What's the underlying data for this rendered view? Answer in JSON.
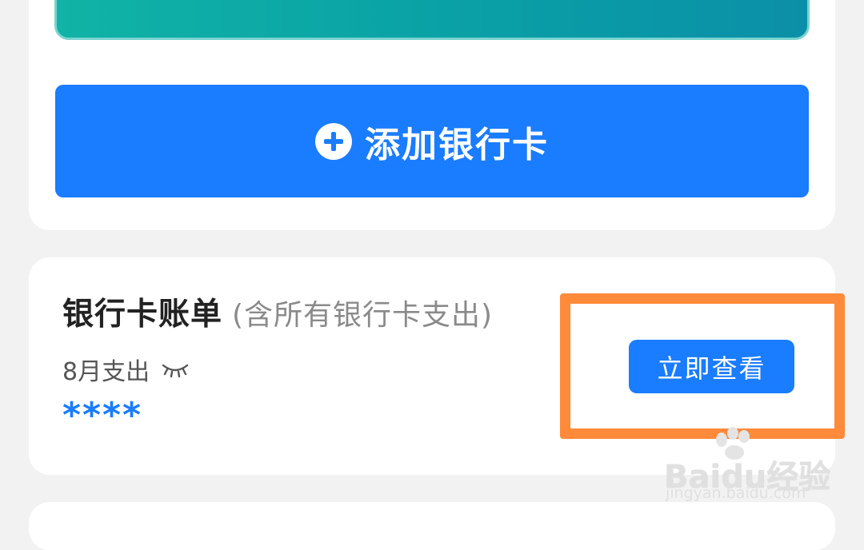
{
  "add_card": {
    "label": "添加银行卡",
    "icon": "plus-circle-icon",
    "color": "#1a7cff"
  },
  "bill_section": {
    "title": "银行卡账单",
    "subtitle": "(含所有银行卡支出)",
    "expense_label": "8月支出",
    "toggle_icon": "eye-closed-icon",
    "amount_masked": "****",
    "action_label": "立即查看"
  },
  "highlight": {
    "color": "#ff8a3a"
  },
  "watermark": {
    "logo_text": "Baidu经验",
    "url": "jingyan.baidu.com"
  }
}
